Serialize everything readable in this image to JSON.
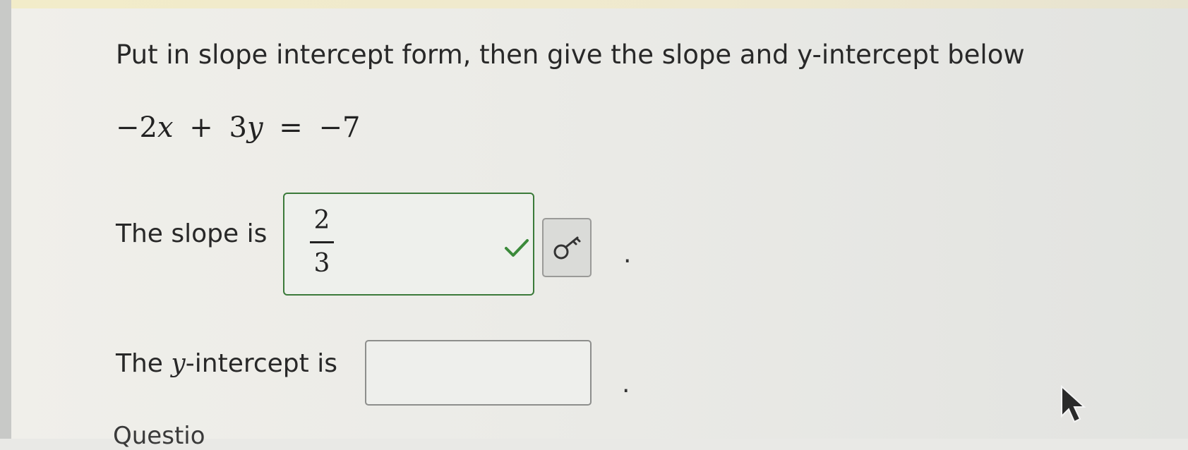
{
  "question": {
    "prompt": "Put in slope intercept form, then give the slope and y-intercept below",
    "equation": {
      "term1": "−2",
      "var1": "x",
      "op1": "+",
      "term2": "3",
      "var2": "y",
      "eq": "=",
      "rhs": "−7"
    }
  },
  "slope": {
    "label": "The slope is",
    "answer_numerator": "2",
    "answer_denominator": "3",
    "status": "correct",
    "status_icon": "check-icon",
    "status_color": "#3b8a3a",
    "tool_icon": "key-icon",
    "trailing": "."
  },
  "y_intercept": {
    "label_prefix": "The",
    "label_var": "y",
    "label_suffix": "-intercept is",
    "value": "",
    "trailing": "."
  },
  "footer": {
    "partial_text": "Questio"
  }
}
